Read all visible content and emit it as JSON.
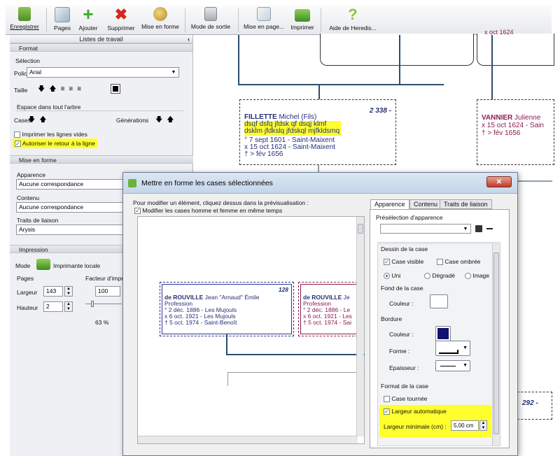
{
  "toolbar": {
    "buttons": [
      {
        "label": "Enregistrer"
      },
      {
        "label": "Pages"
      },
      {
        "label": "Ajouter"
      },
      {
        "label": "Supprimer"
      },
      {
        "label": "Mise en forme"
      },
      {
        "label": "Mode de sortie"
      },
      {
        "label": "Mise en page..."
      },
      {
        "label": "Imprimer"
      },
      {
        "label": "Aide de Heredis..."
      }
    ]
  },
  "left_panel": {
    "title": "Listes de travail",
    "collapse_glyph": "‹",
    "format": {
      "header": "Format",
      "selection_label": "Sélection",
      "font_label": "Police",
      "font_value": "Arial",
      "size_label": "Taille",
      "space_header": "Espace dans tout l'arbre",
      "boxes_label": "Cases",
      "generations_label": "Générations",
      "print_empty_lines": "Imprimer les lignes vides",
      "wrap_lines": "Autoriser le retour à la ligne"
    },
    "layout": {
      "header": "Mise en forme",
      "appearance_label": "Apparence",
      "appearance_value": "Aucune correspondance",
      "content_label": "Contenu",
      "content_value": "Aucune correspondance",
      "link_label": "Traits de liaison",
      "link_value": "Arysis"
    },
    "print": {
      "header": "Impression",
      "mode_label": "Mode",
      "mode_value": "Imprimante locale",
      "pages_label": "Pages",
      "factor_label": "Facteur d'impr",
      "width_label": "Largeur",
      "width_value": "143",
      "height_label": "Hauteur",
      "height_value": "2",
      "factor_value": "100",
      "zoom_value": "63 %"
    }
  },
  "tree": {
    "top_right_snippet": "x oct 1624",
    "center_card": {
      "number": "2 338 -",
      "surname": "FILLETTE",
      "given": "Michel (Fils)",
      "line1": "dsqf dsfq jfdsk qf dsqj klmf",
      "line2": "dsklm jfdkslq jfdskql mjfkldsmq",
      "birth": "° 7 sept 1601 - Saint-Maixent",
      "marriage": "x 15 oct 1624 - Saint-Maixent",
      "death": "† > fév 1656"
    },
    "right_card": {
      "surname": "VANNIER",
      "given": "Julienne",
      "marriage": "x 15 oct 1624 - Sain",
      "death": "† > fév 1656"
    },
    "bottom_right_number": "292 -"
  },
  "dialog": {
    "title": "Mettre en forme les cases sélectionnées",
    "close_glyph": "✕",
    "instruction": "Pour modifier un élément, cliquez dessus dans la prévisualisation :",
    "modify_both": "Modifier les cases homme et femme en même temps",
    "preview_card1": {
      "number": "128",
      "surname": "de ROUVILLE",
      "given": "Jean \"Arnaud\" Émile",
      "profession": "Profession",
      "birth": "° 2 déc. 1886 - Les Mujouls",
      "marriage": "x 6 oct. 1921 - Les Mujouls",
      "death": "† 5 oct. 1974 - Saint-Benoît"
    },
    "preview_card2": {
      "surname": "de ROUVILLE",
      "given": "Je",
      "profession": "Profession",
      "birth": "° 2 déc. 1886 - Le",
      "marriage": "x 6 oct. 1921 - Les",
      "death": "† 5 oct. 1974 - Sai"
    },
    "tabs": [
      "Apparence",
      "Contenu",
      "Traits de liaison"
    ],
    "preset_label": "Présélection d'apparence",
    "drawing_header": "Dessin de la case",
    "visible_box": "Case visible",
    "shadow_box": "Case ombrée",
    "fill_solid": "Uni",
    "fill_gradient": "Dégradé",
    "fill_image": "Image",
    "background_header": "Fond de la case",
    "color_label": "Couleur :",
    "border_header": "Bordure",
    "border_color_label": "Couleur :",
    "shape_label": "Forme :",
    "thickness_label": "Epaisseur :",
    "format_header": "Format de la case",
    "rotated_box": "Case tournée",
    "auto_width": "Largeur automatique",
    "min_width_label": "Largeur minimale (cm) :",
    "min_width_value": "5,00 cm"
  },
  "colors": {
    "border_color": "#10146e",
    "highlight": "#ffff2e",
    "line": "#2d4e6e"
  }
}
